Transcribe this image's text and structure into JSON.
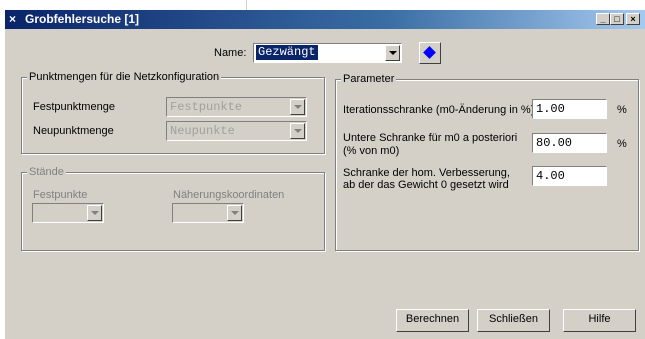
{
  "window": {
    "title": "Grobfehlersuche [1]",
    "icon_glyph": "×",
    "minimize_glyph": "_",
    "maximize_glyph": "□",
    "close_glyph": "×"
  },
  "name_row": {
    "label": "Name:",
    "value": "Gezwängt"
  },
  "netz": {
    "legend": "Punktmengen für die Netzkonfiguration",
    "festpunkt_label": "Festpunktmenge",
    "festpunkt_value": "Festpunkte",
    "neupunkt_label": "Neupunktmenge",
    "neupunkt_value": "Neupunkte"
  },
  "staende": {
    "legend": "Stände",
    "festpunkte_label": "Festpunkte",
    "naeherung_label": "Näherungskoordinaten"
  },
  "parameter": {
    "legend": "Parameter",
    "iter_label": "Iterationsschranke (m0-Änderung in %)",
    "iter_value": "1.00",
    "iter_unit": "%",
    "untere_label_1": "Untere Schranke für m0 a posteriori",
    "untere_label_2": "(% von m0)",
    "untere_value": "80.00",
    "untere_unit": "%",
    "schranke_label_1": "Schranke der hom. Verbesserung,",
    "schranke_label_2": "ab der das Gewicht 0 gesetzt wird",
    "schranke_value": "4.00"
  },
  "buttons": {
    "berechnen": "Berechnen",
    "schliessen": "Schließen",
    "hilfe": "Hilfe"
  },
  "colors": {
    "titlebar": "#0a246a",
    "face": "#d4d0c8",
    "selection": "#0a246a",
    "diamond": "#0000ff"
  }
}
